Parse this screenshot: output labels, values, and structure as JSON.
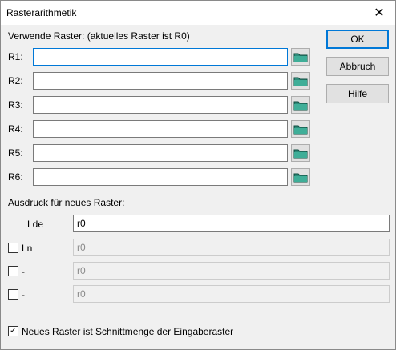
{
  "window": {
    "title": "Rasterarithmetik",
    "close_glyph": "✕"
  },
  "rasters": {
    "heading": "Verwende Raster: (aktuelles Raster ist R0)",
    "rows": [
      {
        "label": "R1:",
        "value": ""
      },
      {
        "label": "R2:",
        "value": ""
      },
      {
        "label": "R3:",
        "value": ""
      },
      {
        "label": "R4:",
        "value": ""
      },
      {
        "label": "R5:",
        "value": ""
      },
      {
        "label": "R6:",
        "value": ""
      }
    ],
    "folder_icon": "folder-icon"
  },
  "buttons": {
    "ok": "OK",
    "cancel": "Abbruch",
    "help": "Hilfe"
  },
  "expression": {
    "heading": "Ausdruck für neues Raster:",
    "lde_label": "Lde",
    "lde_value": "r0",
    "ln_label": "Ln",
    "ln_value": "r0",
    "ln_checked": false,
    "dash1_label": "-",
    "dash1_value": "r0",
    "dash1_checked": false,
    "dash2_label": "-",
    "dash2_value": "r0",
    "dash2_checked": false
  },
  "intersection": {
    "label": "Neues Raster ist Schnittmenge der Eingaberaster",
    "checked": true,
    "check_glyph": "✓"
  },
  "colors": {
    "accent": "#0078d7",
    "folder": "#2e8b7a"
  }
}
